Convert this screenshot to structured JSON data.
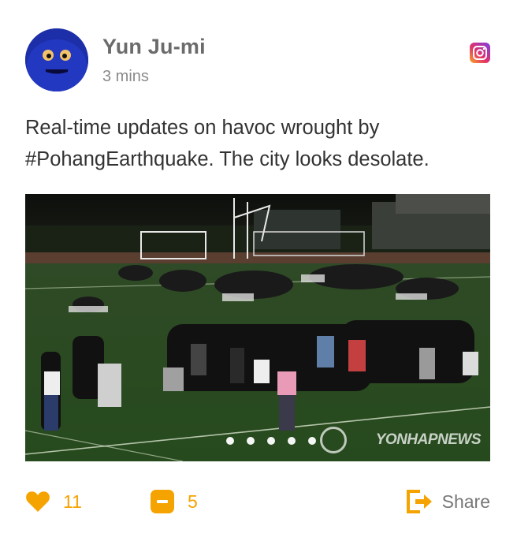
{
  "post": {
    "author": "Yun Ju-mi",
    "time": "3 mins",
    "text": "Real-time updates on havoc wrought by #PohangEarthquake. The city looks desolate.",
    "source_icon": "instagram-icon",
    "photo_watermark": "YONHAPNEWS",
    "carousel_dot_count": 5
  },
  "actions": {
    "likes": "11",
    "comments": "5",
    "share_label": "Share"
  },
  "colors": {
    "accent": "#f5a300",
    "name_text": "#6b6b6b",
    "body_text": "#333333",
    "avatar_bg": "#1d2fa8"
  }
}
